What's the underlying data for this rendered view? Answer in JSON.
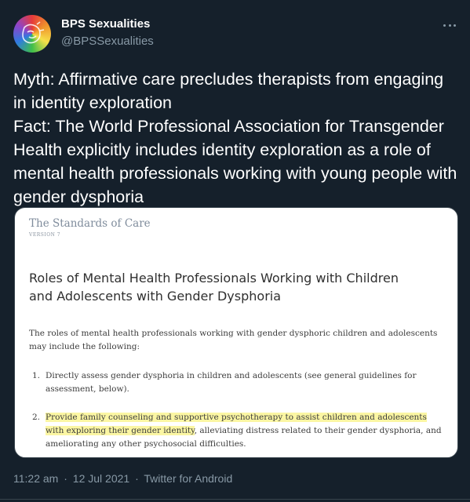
{
  "user": {
    "name": "BPS Sexualities",
    "handle": "@BPSSexualities"
  },
  "tweet": {
    "text": "Myth: Affirmative care precludes therapists from engaging in identity exploration\nFact: The World Professional Association for Transgender Health explicitly includes identity exploration as a role of mental health professionals working with young people with gender dysphoria"
  },
  "image": {
    "doc_title": "The Standards of Care",
    "doc_version": "VERSION 7",
    "heading": "Roles of Mental Health Professionals Working with Children and Adolescents with Gender Dysphoria",
    "intro": "The roles of mental health professionals working with gender dysphoric children and adolescents may include the following:",
    "item1_num": "1.",
    "item1_text": "Directly assess gender dysphoria in children and adolescents (see general guidelines for assessment, below).",
    "item2_num": "2.",
    "item2_highlight": "Provide family counseling and supportive psychotherapy to assist children and adolescents with exploring their gender identity",
    "item2_rest": ", alleviating distress related to their gender dysphoria, and ameliorating any other psychosocial difficulties."
  },
  "meta": {
    "time": "11:22 am",
    "date": "12 Jul 2021",
    "separator": "·",
    "source": "Twitter for Android"
  },
  "colors": {
    "background": "#15202b",
    "secondary_text": "#8899a6",
    "highlight": "#fbf6a3"
  },
  "icons": {
    "more": "more-horizontal-icon"
  }
}
